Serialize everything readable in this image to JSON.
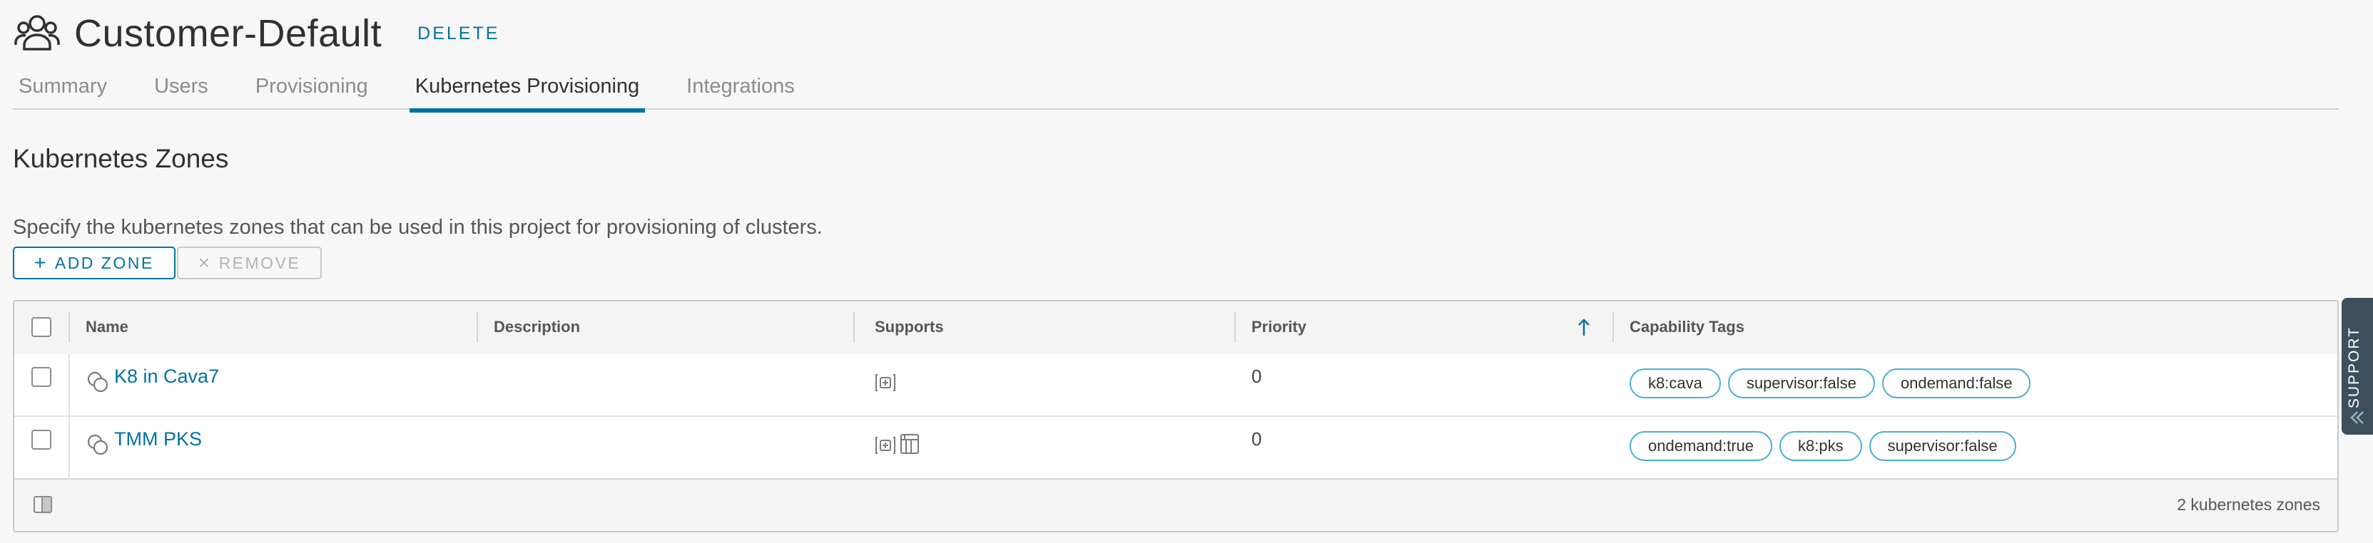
{
  "header": {
    "title": "Customer-Default",
    "delete_label": "DELETE",
    "icon": "users-group-icon"
  },
  "tabs": [
    {
      "label": "Summary",
      "active": false
    },
    {
      "label": "Users",
      "active": false
    },
    {
      "label": "Provisioning",
      "active": false
    },
    {
      "label": "Kubernetes Provisioning",
      "active": true
    },
    {
      "label": "Integrations",
      "active": false
    }
  ],
  "section": {
    "title": "Kubernetes Zones",
    "description": "Specify the kubernetes zones that can be used in this project for provisioning of clusters."
  },
  "actions": {
    "add_zone_label": "ADD ZONE",
    "add_zone_icon": "plus-icon",
    "remove_label": "REMOVE",
    "remove_icon": "close-icon"
  },
  "grid": {
    "columns": [
      "Name",
      "Description",
      "Supports",
      "Priority",
      "Capability Tags"
    ],
    "sorted_column": "Priority",
    "sort_direction": "ascending",
    "rows": [
      {
        "name": "K8 in Cava7",
        "description": "",
        "supports": [
          "cluster-icon"
        ],
        "priority": "0",
        "tags": [
          "k8:cava",
          "supervisor:false",
          "ondemand:false"
        ]
      },
      {
        "name": "TMM PKS",
        "description": "",
        "supports": [
          "cluster-icon",
          "namespace-icon"
        ],
        "priority": "0",
        "tags": [
          "ondemand:true",
          "k8:pks",
          "supervisor:false"
        ]
      }
    ],
    "footer_count": "2 kubernetes zones"
  },
  "support_tab": {
    "label": "SUPPORT"
  },
  "colors": {
    "accent": "#0072a3",
    "tag_border": "#49afd9",
    "background": "#f7f7f7",
    "support_tab": "#3d4f5c"
  }
}
